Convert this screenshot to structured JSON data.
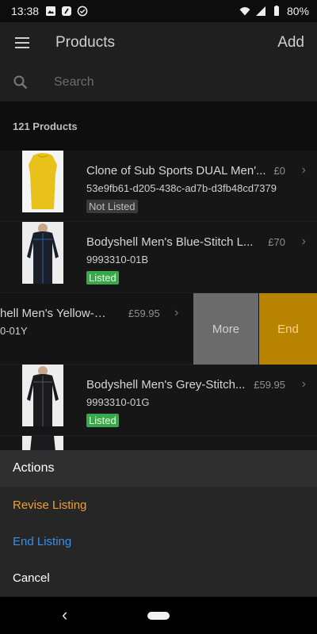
{
  "status_bar": {
    "time": "13:38",
    "battery": "80%"
  },
  "header": {
    "title": "Products",
    "add_label": "Add"
  },
  "search": {
    "placeholder": "Search"
  },
  "list": {
    "count_label": "121 Products",
    "items": [
      {
        "title": "Clone of Sub Sports DUAL Men'...",
        "price": "£0",
        "sku": "53e9fb61-d205-438c-ad7b-d3fb48cd7379",
        "status": "Not Listed",
        "status_color": "#3a3a3a",
        "thumb": "yellow-shirt"
      },
      {
        "title": "Bodyshell Men's Blue-Stitch L...",
        "price": "£70",
        "sku": "9993310-01B",
        "status": "Listed",
        "status_color": "#39a84a",
        "thumb": "black-shirt"
      },
      {
        "title": "hell Men's Yellow-Stit...",
        "price": "£59.95",
        "sku": "0-01Y",
        "swipe_actions": [
          "More",
          "End"
        ]
      },
      {
        "title": "Bodyshell Men's Grey-Stitch...",
        "price": "£59.95",
        "sku": "9993310-01G",
        "status": "Listed",
        "status_color": "#39a84a",
        "thumb": "black-shirt"
      }
    ]
  },
  "action_sheet": {
    "title": "Actions",
    "items": [
      {
        "label": "Revise Listing",
        "color": "#f0a030"
      },
      {
        "label": "End Listing",
        "color": "#3a8ee8"
      },
      {
        "label": "Cancel",
        "color": "#ffffff"
      }
    ]
  },
  "colors": {
    "end_swipe": "#b88400",
    "more_swipe": "#6b6b6b",
    "listed_badge": "#39a84a"
  }
}
